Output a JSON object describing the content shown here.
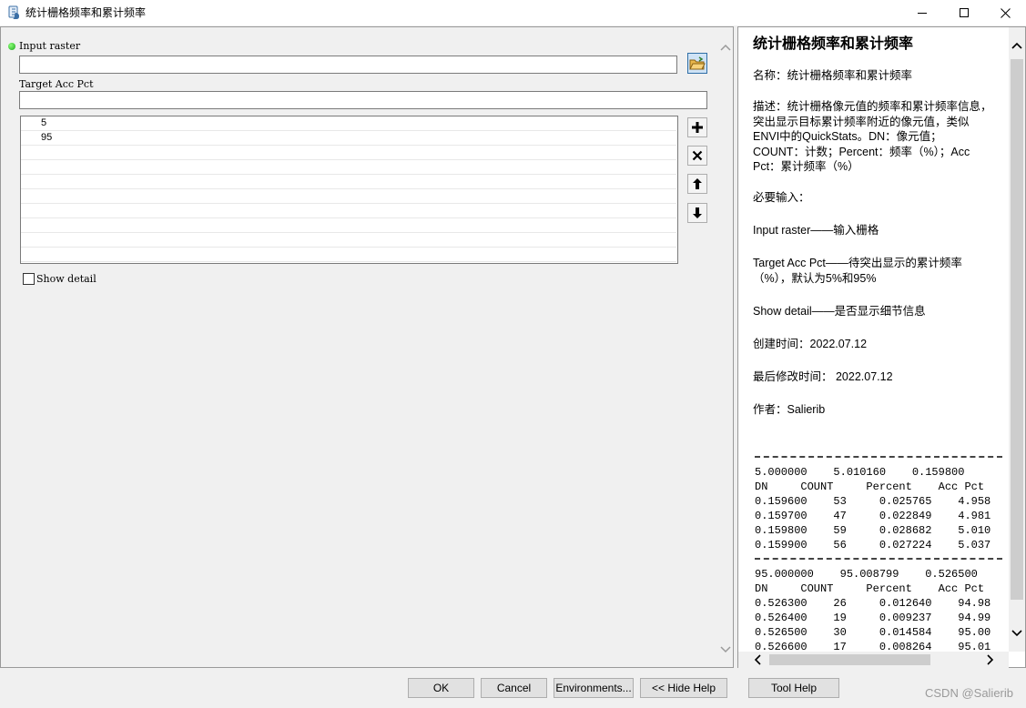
{
  "window": {
    "title": "统计栅格频率和累计频率",
    "min_symbol": "—",
    "max_symbol": "☐",
    "close_symbol": "✕"
  },
  "form": {
    "input_raster_label": "Input raster",
    "input_raster_value": "",
    "target_label": "Target Acc Pct",
    "target_value": "",
    "target_list": [
      "5",
      "95",
      "",
      "",
      "",
      "",
      "",
      "",
      "",
      ""
    ],
    "show_detail_label": "Show detail",
    "show_detail_checked": false
  },
  "help": {
    "title": "统计栅格频率和累计频率",
    "name": "名称：统计栅格频率和累计频率",
    "description": "描述：统计栅格像元值的频率和累计频率信息，突出显示目标累计频率附近的像元值，类似ENVI中的QuickStats。DN：像元值；COUNT：计数；Percent：频率（%）；Acc Pct：累计频率（%）",
    "required": "必要输入：",
    "param_input_raster": "Input raster——输入栅格",
    "param_target": "Target Acc Pct——待突出显示的累计频率（%），默认为5%和95%",
    "param_show_detail": "Show detail——是否显示细节信息",
    "created": "创建时间：2022.07.12",
    "modified": "最后修改时间： 2022.07.12",
    "author": "作者：Salierib",
    "output_lines": [
      "5.000000    5.010160    0.159800",
      "DN     COUNT     Percent    Acc Pct",
      "0.159600    53     0.025765    4.958",
      "0.159700    47     0.022849    4.981",
      "0.159800    59     0.028682    5.010",
      "0.159900    56     0.027224    5.037",
      "95.000000    95.008799    0.526500",
      "DN     COUNT     Percent    Acc Pct",
      "0.526300    26     0.012640    94.98",
      "0.526400    19     0.009237    94.99",
      "0.526500    30     0.014584    95.00",
      "0.526600    17     0.008264    95.01"
    ]
  },
  "buttons": {
    "ok": "OK",
    "cancel": "Cancel",
    "environments": "Environments...",
    "hide_help": "<< Hide Help",
    "tool_help": "Tool Help"
  },
  "watermark": "CSDN @Salierib",
  "colors": {
    "required_dot": "#1aa51a",
    "browse_button": "#cfe3f6",
    "window_bg": "#f0f0f0",
    "help_bg": "#ffffff"
  },
  "icons": {
    "app": "python-script-icon",
    "browse": "open-folder-icon",
    "add": "plus-icon",
    "remove": "x-icon",
    "move_up": "arrow-up-icon",
    "move_down": "arrow-down-icon"
  }
}
